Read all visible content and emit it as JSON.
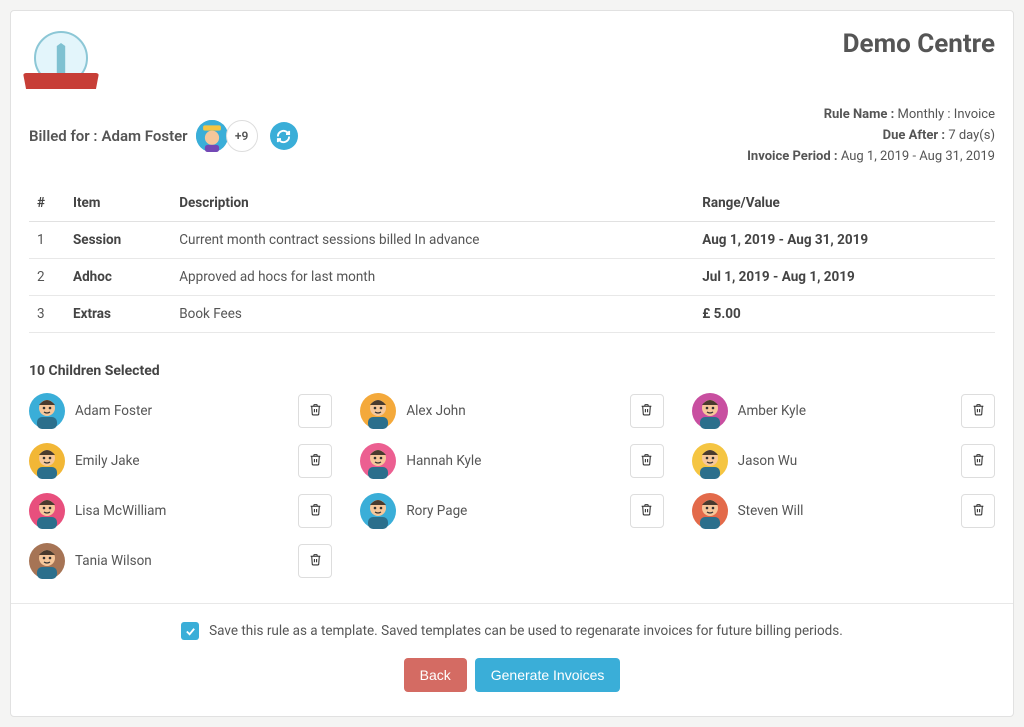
{
  "header": {
    "centre_title": "Demo Centre"
  },
  "billed": {
    "label": "Billed for :",
    "name": "Adam Foster",
    "extra_count": "+9"
  },
  "meta": {
    "rule_name_label": "Rule Name :",
    "rule_name_value": "Monthly : Invoice",
    "due_label": "Due After :",
    "due_value": "7 day(s)",
    "period_label": "Invoice Period :",
    "period_value": "Aug 1, 2019 - Aug 31, 2019"
  },
  "table": {
    "headers": {
      "num": "#",
      "item": "Item",
      "desc": "Description",
      "range": "Range/Value"
    },
    "rows": [
      {
        "num": "1",
        "item": "Session",
        "desc": "Current month contract sessions billed In advance",
        "range": "Aug 1, 2019 - Aug 31, 2019"
      },
      {
        "num": "2",
        "item": "Adhoc",
        "desc": "Approved ad hocs for last month",
        "range": "Jul 1, 2019 - Aug 1, 2019"
      },
      {
        "num": "3",
        "item": "Extras",
        "desc": "Book Fees",
        "range": "£ 5.00"
      }
    ]
  },
  "children": {
    "title": "10 Children Selected",
    "list": [
      {
        "name": "Adam Foster",
        "color": "#3aaed8"
      },
      {
        "name": "Alex John",
        "color": "#f4a93b"
      },
      {
        "name": "Amber Kyle",
        "color": "#c84fa0"
      },
      {
        "name": "Emily Jake",
        "color": "#f2b736"
      },
      {
        "name": "Hannah Kyle",
        "color": "#ec5f91"
      },
      {
        "name": "Jason Wu",
        "color": "#f5c542"
      },
      {
        "name": "Lisa McWilliam",
        "color": "#e84f7d"
      },
      {
        "name": "Rory Page",
        "color": "#3aaed8"
      },
      {
        "name": "Steven Will",
        "color": "#e36a4a"
      },
      {
        "name": "Tania Wilson",
        "color": "#a67455"
      }
    ]
  },
  "footer": {
    "checkbox_label": "Save this rule as a template. Saved templates can be used to regenarate invoices for future billing periods.",
    "back": "Back",
    "generate": "Generate Invoices"
  }
}
